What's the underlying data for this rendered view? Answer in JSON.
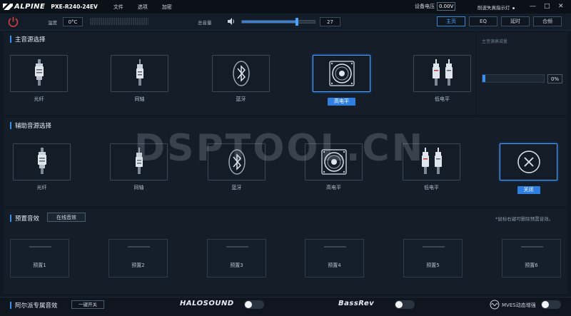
{
  "app": {
    "brand": "ALPINE",
    "model": "PXE-R240-24EV",
    "menu": [
      "文件",
      "选项",
      "加密"
    ],
    "voltage_label": "设备电压",
    "voltage_value": "0.00V",
    "indicator_label": "削波失真指示灯",
    "window_controls": {
      "minimize": "—",
      "maximize": "□",
      "close": "✕"
    }
  },
  "toolbar": {
    "temp_label": "温度",
    "temp_value": "0°C",
    "master_label": "总音量",
    "master_value": "27",
    "master_level": 0.75,
    "tabs": [
      {
        "label": "主页",
        "active": true
      },
      {
        "label": "EQ",
        "active": false
      },
      {
        "label": "延时",
        "active": false
      },
      {
        "label": "合频",
        "active": false
      }
    ]
  },
  "main_source": {
    "title": "主音源选择",
    "items": [
      {
        "label": "光纤",
        "icon": "optical-icon",
        "selected": false
      },
      {
        "label": "同轴",
        "icon": "coaxial-icon",
        "selected": false
      },
      {
        "label": "蓝牙",
        "icon": "bluetooth-icon",
        "selected": false
      },
      {
        "label": "高电平",
        "icon": "speaker-icon",
        "selected": true
      },
      {
        "label": "低电平",
        "icon": "rca-icon",
        "selected": false
      }
    ],
    "side_label": "主音源衰减量",
    "side_value": "0%",
    "side_level": 0
  },
  "aux_source": {
    "title": "辅助音源选择",
    "items": [
      {
        "label": "光纤",
        "icon": "optical-icon",
        "selected": false
      },
      {
        "label": "同轴",
        "icon": "coaxial-icon",
        "selected": false
      },
      {
        "label": "蓝牙",
        "icon": "bluetooth-icon",
        "selected": false
      },
      {
        "label": "高电平",
        "icon": "speaker-icon",
        "selected": false
      },
      {
        "label": "低电平",
        "icon": "rca-icon",
        "selected": false
      },
      {
        "label": "关闭",
        "icon": "close-circle-icon",
        "selected": true
      }
    ]
  },
  "presets": {
    "title": "预置音效",
    "online_button": "在线音效",
    "hint": "*鼠标右键可删除预置音效。",
    "items": [
      "预置1",
      "预置2",
      "预置3",
      "预置4",
      "预置5",
      "预置6"
    ]
  },
  "bottom": {
    "title": "阿尔派专属音效",
    "onekey": "一键开关",
    "halo_logo": "HALOSOUND",
    "bassrev_logo": "BassRev",
    "mves_label": "MVES动态增强"
  },
  "watermark": "DSPTOOL.CN",
  "colors": {
    "accent": "#3a8ff0",
    "bg": "#101823",
    "power": "#d23a3a"
  }
}
